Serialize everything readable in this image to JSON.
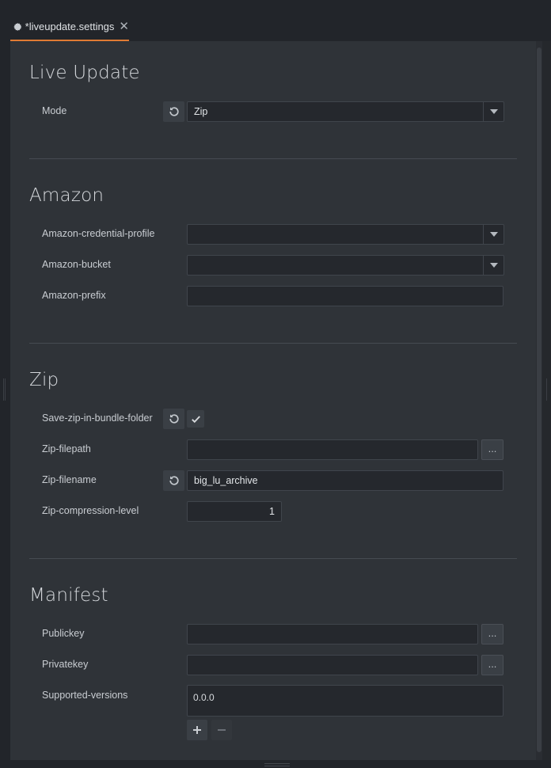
{
  "tab": {
    "title": "*liveupdate.settings",
    "close": "✕"
  },
  "sections": {
    "liveupdate": {
      "title": "Live Update",
      "mode_label": "Mode",
      "mode_value": "Zip"
    },
    "amazon": {
      "title": "Amazon",
      "credential_profile_label": "Amazon-credential-profile",
      "credential_profile_value": "",
      "bucket_label": "Amazon-bucket",
      "bucket_value": "",
      "prefix_label": "Amazon-prefix",
      "prefix_value": ""
    },
    "zip": {
      "title": "Zip",
      "save_in_bundle_label": "Save-zip-in-bundle-folder",
      "save_in_bundle_checked": true,
      "filepath_label": "Zip-filepath",
      "filepath_value": "",
      "filename_label": "Zip-filename",
      "filename_value": "big_lu_archive",
      "compression_label": "Zip-compression-level",
      "compression_value": "1"
    },
    "manifest": {
      "title": "Manifest",
      "publickey_label": "Publickey",
      "publickey_value": "",
      "privatekey_label": "Privatekey",
      "privatekey_value": "",
      "supported_versions_label": "Supported-versions",
      "supported_versions": [
        "0.0.0"
      ]
    }
  },
  "buttons": {
    "ellipsis": "...",
    "add": "+",
    "remove": "−"
  },
  "icons": {
    "tab": "gear-icon",
    "reset": "reset-icon",
    "dropdown": "chevron-down-icon",
    "check": "check-icon"
  },
  "colors": {
    "accent": "#e07b34",
    "panel": "#2f3338",
    "background": "#22252a",
    "field": "#25282d"
  }
}
